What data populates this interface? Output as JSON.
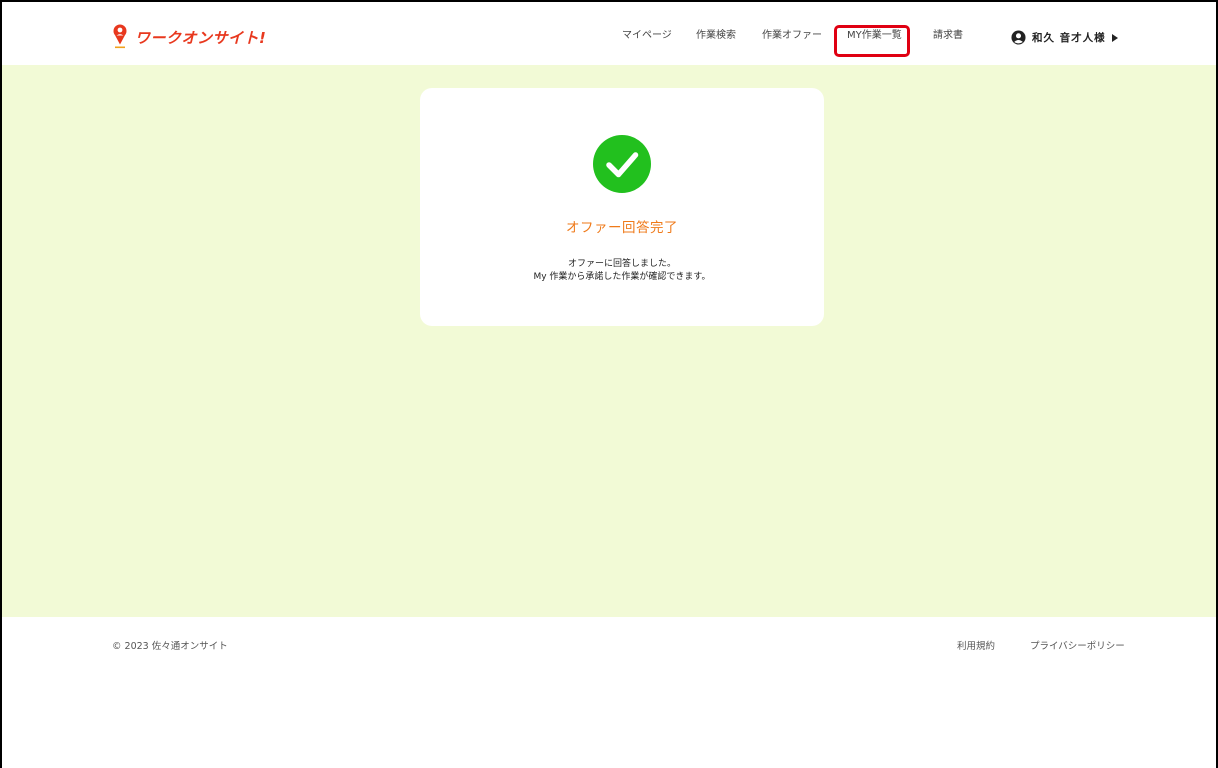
{
  "brand": {
    "logo_text": "ワークオンサイト!",
    "accent": "#e8381e"
  },
  "nav": {
    "items": [
      {
        "label": "マイページ"
      },
      {
        "label": "作業検索"
      },
      {
        "label": "作業オファー"
      },
      {
        "label": "MY作業一覧",
        "highlighted": true
      },
      {
        "label": "請求書"
      }
    ],
    "highlight_color": "#e00012"
  },
  "user": {
    "name": "和久 音才人様",
    "icon": "user-circle-icon"
  },
  "main": {
    "background": "#f2fad6",
    "card": {
      "icon": "check-circle-icon",
      "icon_color": "#22c01e",
      "title": "オファー回答完了",
      "title_color": "#ef7a1a",
      "message_line1": "オファーに回答しました。",
      "message_line2": "My 作業から承諾した作業が確認できます。"
    }
  },
  "footer": {
    "copyright": "© 2023 佐々通オンサイト",
    "links": [
      {
        "label": "利用規約"
      },
      {
        "label": "プライバシーポリシー"
      }
    ]
  }
}
